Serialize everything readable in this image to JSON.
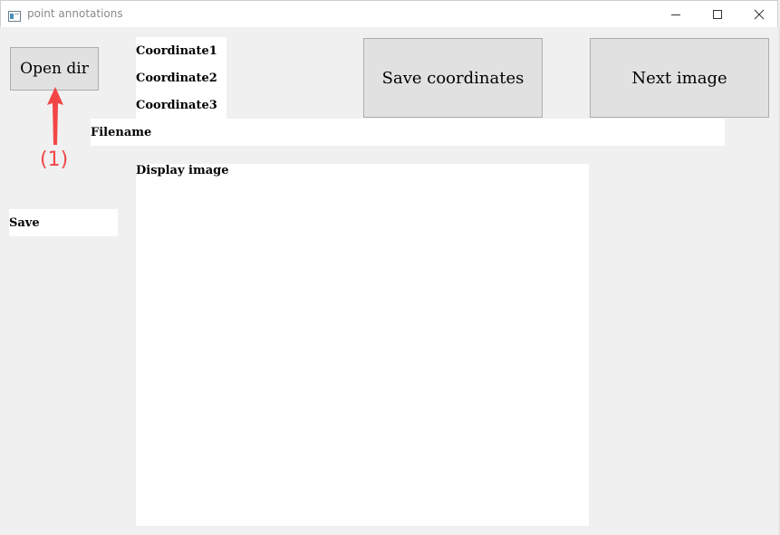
{
  "window": {
    "title": "point annotations",
    "controls": {
      "minimize": "minimize",
      "maximize": "maximize",
      "close": "close"
    }
  },
  "buttons": {
    "open_dir": "Open dir",
    "save_coordinates": "Save coordinates",
    "next_image": "Next image"
  },
  "labels": {
    "coordinate1": "Coordinate1",
    "coordinate2": "Coordinate2",
    "coordinate3": "Coordinate3",
    "filename": "Filename",
    "save": "Save",
    "display_image": "Display image"
  },
  "annotation": {
    "text": "(1)",
    "color": "#f24646"
  },
  "colors": {
    "window_bg": "#f0f0f0",
    "button_bg": "#e1e1e1",
    "button_border": "#adadad",
    "label_bg": "#ffffff"
  }
}
